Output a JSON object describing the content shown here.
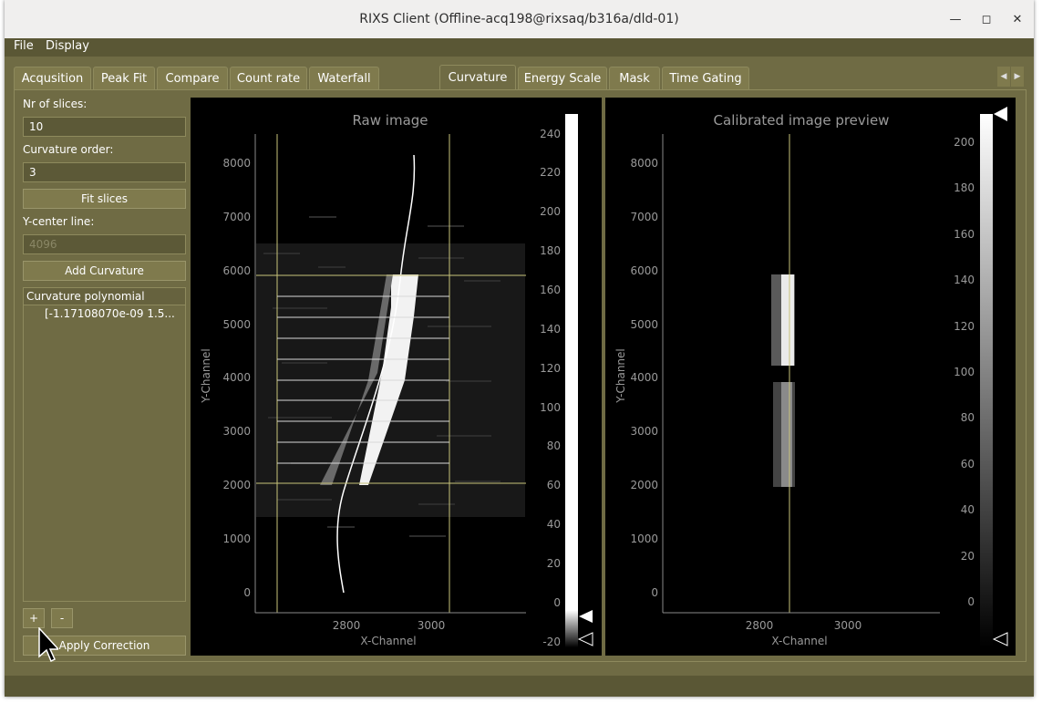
{
  "window": {
    "title": "RIXS Client (Offline-acq198@rixsaq/b316a/dld-01)"
  },
  "menu": [
    "File",
    "Display"
  ],
  "tabs": [
    {
      "label": "Acqusition"
    },
    {
      "label": "Peak Fit"
    },
    {
      "label": "Compare"
    },
    {
      "label": "Count rate"
    },
    {
      "label": "Waterfall"
    },
    {
      "label": "Curvature",
      "active": true
    },
    {
      "label": "Energy Scale"
    },
    {
      "label": "Mask"
    },
    {
      "label": "Time Gating"
    }
  ],
  "controls": {
    "nr_slices_label": "Nr of slices:",
    "nr_slices_value": "10",
    "curvature_order_label": "Curvature order:",
    "curvature_order_value": "3",
    "fit_slices_label": "Fit slices",
    "y_center_label": "Y-center line:",
    "y_center_value": "4096",
    "add_curvature_label": "Add Curvature",
    "poly_header": "Curvature polynomial",
    "poly_value": "[-1.17108070e-09  1.5...",
    "plus_label": "+",
    "minus_label": "-",
    "apply_label": "Apply Correction"
  },
  "raw_plot": {
    "title": "Raw image",
    "xlabel": "X-Channel",
    "ylabel": "Y-Channel",
    "xticks": [
      "2800",
      "3000"
    ],
    "yticks": [
      "0",
      "1000",
      "2000",
      "3000",
      "4000",
      "5000",
      "6000",
      "7000",
      "8000"
    ],
    "colorbar_ticks": [
      "-20",
      "0",
      "20",
      "40",
      "60",
      "80",
      "100",
      "120",
      "140",
      "160",
      "180",
      "200",
      "220",
      "240"
    ]
  },
  "calib_plot": {
    "title": "Calibrated image preview",
    "xlabel": "X-Channel",
    "ylabel": "Y-Channel",
    "xticks": [
      "2800",
      "3000"
    ],
    "yticks": [
      "0",
      "1000",
      "2000",
      "3000",
      "4000",
      "5000",
      "6000",
      "7000",
      "8000"
    ],
    "colorbar_ticks": [
      "0",
      "20",
      "40",
      "60",
      "80",
      "100",
      "120",
      "140",
      "160",
      "180",
      "200"
    ]
  },
  "colors": {
    "window_bg": "#6f6b44",
    "plot_bg": "#000000",
    "guide_line": "#c8c37a",
    "axis": "#8a8a8a"
  }
}
